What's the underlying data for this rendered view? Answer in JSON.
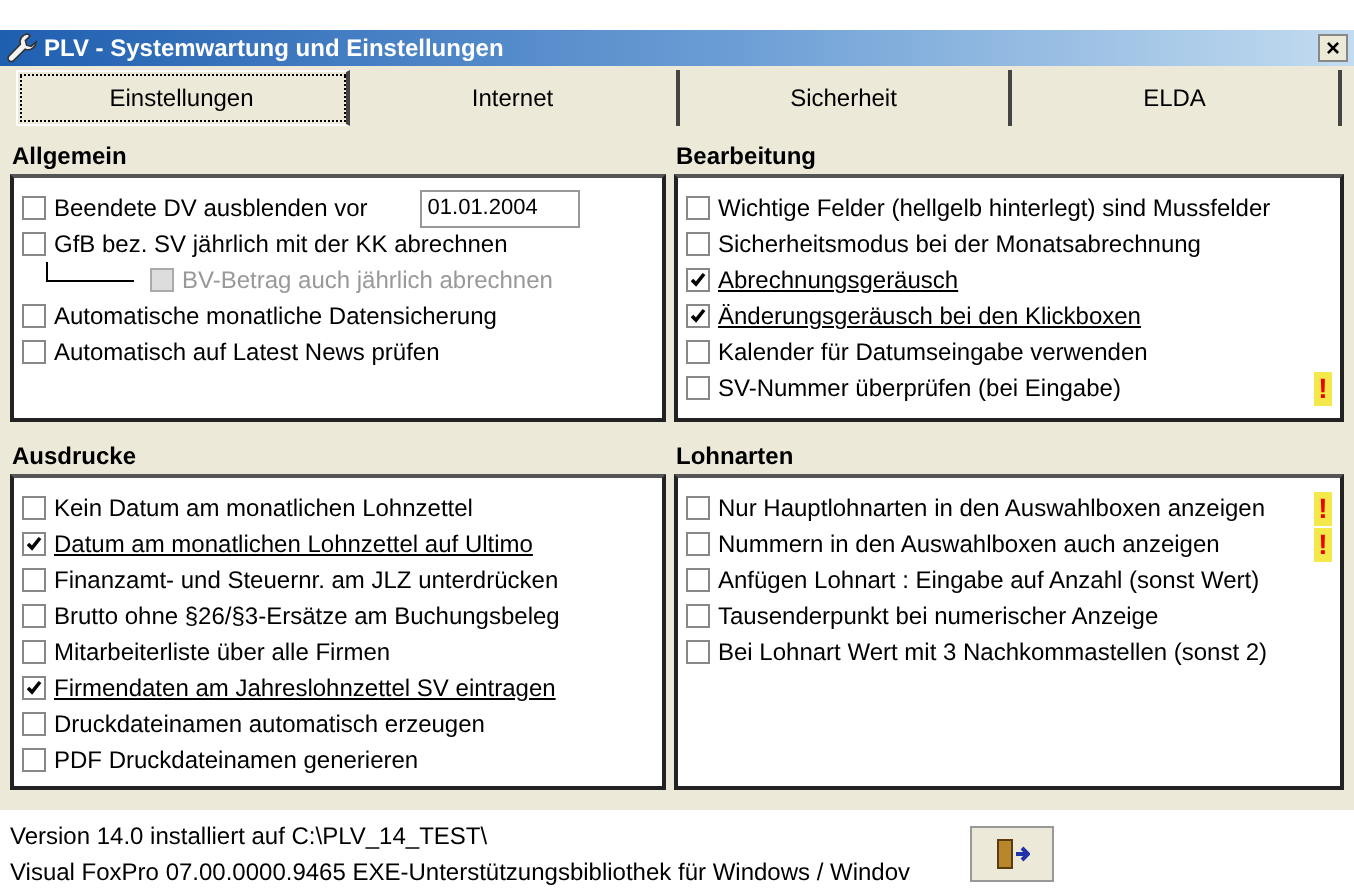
{
  "window": {
    "title": "PLV - Systemwartung und Einstellungen",
    "close": "×"
  },
  "tabs": [
    {
      "label": "Einstellungen",
      "selected": true
    },
    {
      "label": "Internet",
      "selected": false
    },
    {
      "label": "Sicherheit",
      "selected": false
    },
    {
      "label": "ELDA",
      "selected": false
    }
  ],
  "groups": [
    {
      "title": "Allgemein",
      "items": [
        {
          "label": "Beendete DV ausblenden vor",
          "checked": false,
          "value": "01.01.2004"
        },
        {
          "label": "GfB bez. SV jährlich mit der KK abrechnen",
          "checked": false,
          "children": [
            {
              "label": "BV-Betrag auch jährlich abrechnen",
              "checked": false,
              "disabled": true
            }
          ]
        },
        {
          "label": "Automatische monatliche Datensicherung",
          "checked": false
        },
        {
          "label": "Automatisch auf Latest News prüfen",
          "checked": false
        }
      ]
    },
    {
      "title": "Bearbeitung",
      "items": [
        {
          "label": "Wichtige Felder (hellgelb hinterlegt) sind Mussfelder",
          "checked": false
        },
        {
          "label": "Sicherheitsmodus bei der Monatsabrechnung",
          "checked": false
        },
        {
          "label": "Abrechnungsgeräusch",
          "checked": true
        },
        {
          "label": "Änderungsgeräusch bei den Klickboxen",
          "checked": true
        },
        {
          "label": "Kalender für Datumseingabe verwenden",
          "checked": false
        },
        {
          "label": "SV-Nummer überprüfen (bei Eingabe)",
          "checked": false,
          "warning": "!"
        }
      ]
    },
    {
      "title": "Ausdrucke",
      "items": [
        {
          "label": "Kein Datum am monatlichen Lohnzettel",
          "checked": false
        },
        {
          "label": "Datum am monatlichen Lohnzettel  auf Ultimo",
          "checked": true
        },
        {
          "label": "Finanzamt- und Steuernr. am JLZ unterdrücken",
          "checked": false
        },
        {
          "label": "Brutto ohne §26/§3-Ersätze am Buchungsbeleg",
          "checked": false
        },
        {
          "label": "Mitarbeiterliste über alle Firmen",
          "checked": false
        },
        {
          "label": "Firmendaten am Jahreslohnzettel SV eintragen",
          "checked": true
        },
        {
          "label": "Druckdateinamen automatisch erzeugen",
          "checked": false
        },
        {
          "label": "PDF Druckdateinamen generieren",
          "checked": false
        }
      ]
    },
    {
      "title": "Lohnarten",
      "items": [
        {
          "label": "Nur Hauptlohnarten in den Auswahlboxen anzeigen",
          "checked": false,
          "warning": "!"
        },
        {
          "label": "Nummern in den Auswahlboxen auch anzeigen",
          "checked": false,
          "warning": "!"
        },
        {
          "label": "Anfügen Lohnart : Eingabe auf Anzahl (sonst Wert)",
          "checked": false
        },
        {
          "label": "Tausenderpunkt bei numerischer Anzeige",
          "checked": false
        },
        {
          "label": "Bei Lohnart Wert mit 3 Nachkommastellen (sonst 2)",
          "checked": false
        }
      ]
    }
  ],
  "footer": {
    "lines": [
      "Version 14.0 installiert auf C:\\PLV_14_TEST\\",
      "Visual FoxPro 07.00.0000.9465 EXE-Unterstützungsbibliothek für Windows / Windov"
    ]
  }
}
